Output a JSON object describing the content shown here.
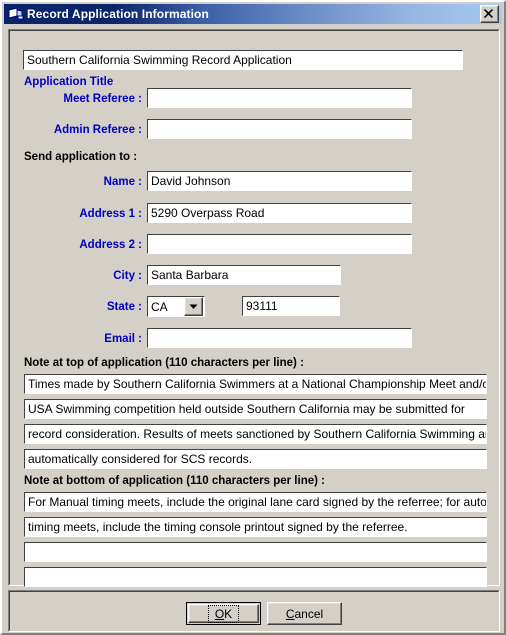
{
  "window": {
    "title": "Record Application Information",
    "icon": "vb-form-icon",
    "close_label": "close-icon",
    "colors": {
      "title_gradient_start": "#0a246a",
      "title_gradient_end": "#a6caf0",
      "face": "#d4d0c8",
      "label_blue": "#0000c0",
      "field_bg": "#ffffff"
    }
  },
  "form": {
    "application_title": {
      "value": "Southern California Swimming Record Application",
      "caption": "Application Title"
    },
    "meet_referee": {
      "label": "Meet Referee :",
      "value": ""
    },
    "admin_referee": {
      "label": "Admin Referee :",
      "value": ""
    },
    "send_to_heading": "Send application to :",
    "name": {
      "label": "Name :",
      "value": "David Johnson"
    },
    "address1": {
      "label": "Address 1 :",
      "value": "5290 Overpass Road"
    },
    "address2": {
      "label": "Address 2 :",
      "value": ""
    },
    "city": {
      "label": "City :",
      "value": "Santa Barbara"
    },
    "state": {
      "label": "State :",
      "value": "CA",
      "options": [
        "CA"
      ]
    },
    "zip": {
      "value": "93111"
    },
    "email": {
      "label": "Email :",
      "value": ""
    }
  },
  "note_top": {
    "heading": "Note at top of application (110 characters per line) :",
    "lines": [
      "Times made by Southern California Swimmers at a National Championship Meet and/or other sanctioned",
      "USA Swimming competition held outside Southern California may be submitted for",
      "record consideration.  Results of meets sanctioned by Southern California Swimming are",
      "automatically considered for SCS records."
    ]
  },
  "note_bottom": {
    "heading": "Note at bottom of application (110 characters per line) :",
    "lines": [
      "For Manual timing meets, include the original lane card signed by the referree; for automatic",
      "timing meets, include the timing console printout signed by the referree.",
      "",
      ""
    ]
  },
  "buttons": {
    "ok": {
      "label": "OK",
      "accel": "O"
    },
    "cancel": {
      "label": "Cancel",
      "accel": "C"
    }
  }
}
